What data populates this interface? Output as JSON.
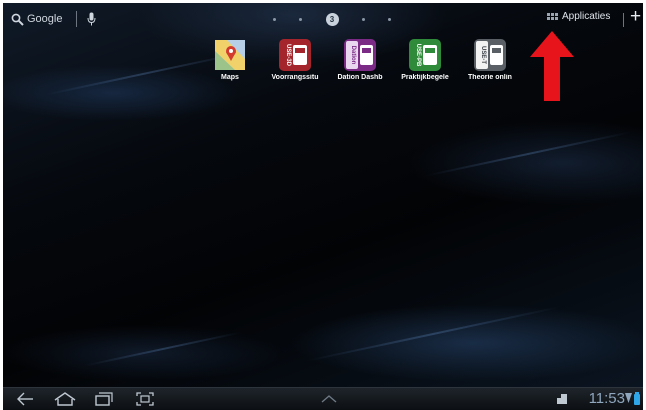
{
  "top_bar": {
    "search_label": "Google",
    "apps_label": "Applicaties",
    "active_page": "3"
  },
  "shortcuts": [
    {
      "label": "Maps",
      "icon": "maps-icon"
    },
    {
      "label": "Voorrangssitu",
      "icon_text": "USE-3D",
      "color": "#a4262c"
    },
    {
      "label": "Dation Dashb",
      "icon_text": "Dation",
      "color": "#7b2b86"
    },
    {
      "label": "Praktijkbegele",
      "icon_text": "USE-PB",
      "color": "#2f8b3a"
    },
    {
      "label": "Theorie onlin",
      "icon_text": "USE-T",
      "color": "#5a5f66"
    }
  ],
  "annotation": {
    "arrow_color": "#e8141b"
  },
  "status_bar": {
    "time": "11:53"
  }
}
